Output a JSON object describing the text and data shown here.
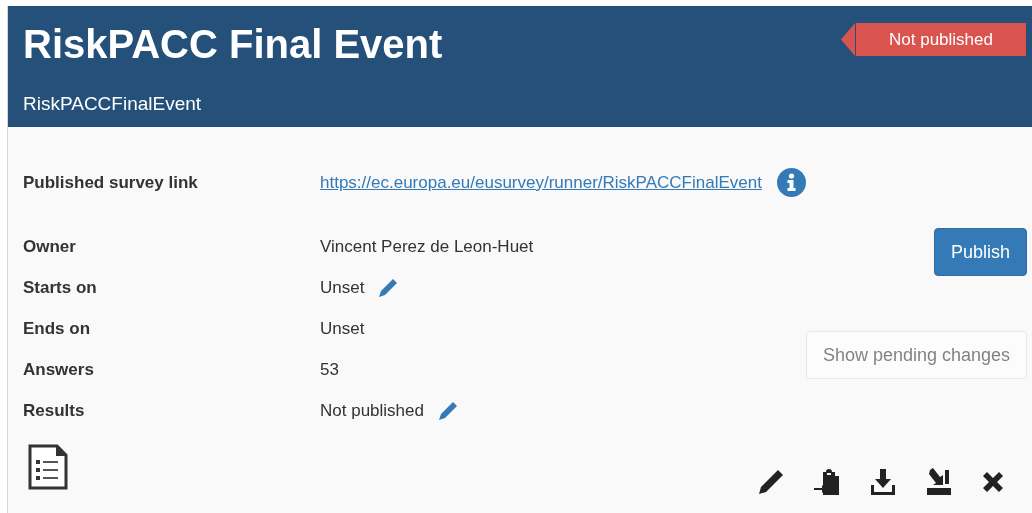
{
  "header": {
    "title": "RiskPACC Final Event",
    "alias": "RiskPACCFinalEvent",
    "status_badge": "Not published"
  },
  "link_row": {
    "label": "Published survey link",
    "url": "https://ec.europa.eu/eusurvey/runner/RiskPACCFinalEvent"
  },
  "properties": [
    {
      "label": "Owner",
      "value": "Vincent Perez de Leon-Huet",
      "editable": false
    },
    {
      "label": "Starts on",
      "value": "Unset",
      "editable": true
    },
    {
      "label": "Ends on",
      "value": "Unset",
      "editable": false
    },
    {
      "label": "Answers",
      "value": "53",
      "editable": false
    },
    {
      "label": "Results",
      "value": "Not published",
      "editable": true
    }
  ],
  "buttons": [
    {
      "label": "Publish",
      "kind": "primary",
      "disabled": false
    },
    {
      "label": "Show pending changes",
      "kind": "default",
      "disabled": true
    }
  ]
}
